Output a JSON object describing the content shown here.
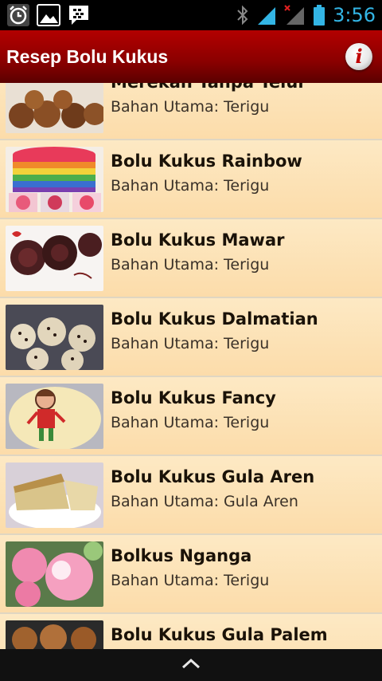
{
  "status_bar": {
    "time": "3:56",
    "icons": [
      "alarm-icon",
      "gallery-icon",
      "bbm-icon",
      "bluetooth-icon",
      "signal-icon",
      "signal-no-data-icon",
      "battery-icon"
    ]
  },
  "action_bar": {
    "title": "Resep Bolu Kukus",
    "info_icon": "info-icon"
  },
  "recipes": [
    {
      "title": "Merekah Tanpa Telur",
      "subtitle": "Bahan Utama: Terigu"
    },
    {
      "title": "Bolu Kukus Rainbow",
      "subtitle": "Bahan Utama: Terigu"
    },
    {
      "title": "Bolu Kukus Mawar",
      "subtitle": "Bahan Utama: Terigu"
    },
    {
      "title": "Bolu Kukus Dalmatian",
      "subtitle": "Bahan Utama: Terigu"
    },
    {
      "title": "Bolu Kukus Fancy",
      "subtitle": "Bahan Utama: Terigu"
    },
    {
      "title": "Bolu Kukus Gula Aren",
      "subtitle": "Bahan Utama: Gula Aren"
    },
    {
      "title": "Bolkus Nganga",
      "subtitle": "Bahan Utama: Terigu"
    },
    {
      "title": "Bolu Kukus Gula Palem",
      "subtitle": ""
    }
  ],
  "nav_bar": {
    "icon": "chevron-up-icon"
  },
  "colors": {
    "action_bar": "#8a0000",
    "list_bg": "#fde2b0",
    "status_time": "#33b5e5"
  }
}
